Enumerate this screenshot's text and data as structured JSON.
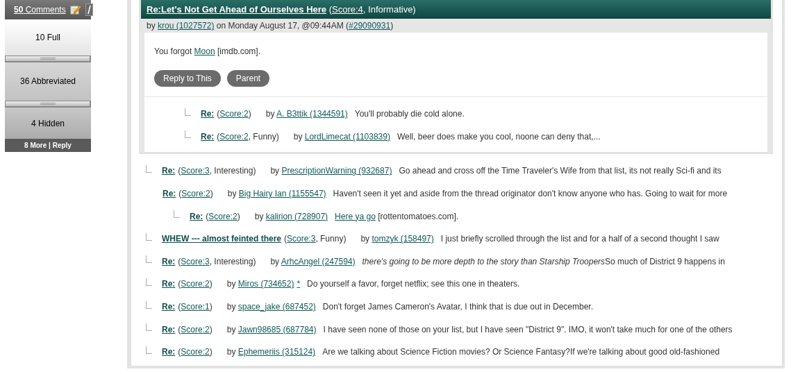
{
  "sidebar": {
    "count": "50",
    "label": "Comments",
    "sections": [
      {
        "label": "10 Full"
      },
      {
        "label": "36 Abbreviated"
      },
      {
        "label": "4 Hidden"
      }
    ],
    "footer": [
      {
        "text": "8 More",
        "kind": "link"
      },
      {
        "text": " | ",
        "kind": "text"
      },
      {
        "text": "Reply",
        "kind": "link"
      }
    ]
  },
  "comment": {
    "title": "Re:Let's Not Get Ahead of Ourselves Here",
    "score": [
      {
        "text": " (",
        "kind": "text"
      },
      {
        "text": "Score:4",
        "kind": "link"
      },
      {
        "text": ", Informative)",
        "kind": "text"
      }
    ],
    "byline": [
      {
        "text": "by ",
        "kind": "text"
      },
      {
        "text": "krou (1027572)",
        "kind": "link"
      },
      {
        "text": " on Monday August 17, @09:44AM (",
        "kind": "text"
      },
      {
        "text": "#29090931",
        "kind": "link"
      },
      {
        "text": ")",
        "kind": "text"
      }
    ],
    "body": [
      {
        "text": "You forgot ",
        "kind": "text"
      },
      {
        "text": "Moon",
        "kind": "link"
      },
      {
        "text": " [imdb.com].",
        "kind": "text"
      }
    ],
    "buttons": [
      "Reply to This",
      "Parent"
    ],
    "children": [
      {
        "connector": true,
        "title": "Re:",
        "score": [
          {
            "text": "(",
            "kind": "text"
          },
          {
            "text": "Score:2",
            "kind": "link"
          },
          {
            "text": ")",
            "kind": "text"
          }
        ],
        "byline": [
          {
            "text": "by ",
            "kind": "text"
          },
          {
            "text": "A. B3ttik (1344591)",
            "kind": "link"
          }
        ],
        "body": [
          {
            "text": "You'll probably die cold alone.",
            "kind": "text"
          }
        ]
      },
      {
        "connector": true,
        "title": "Re:",
        "score": [
          {
            "text": "(",
            "kind": "text"
          },
          {
            "text": "Score:2",
            "kind": "link"
          },
          {
            "text": ", Funny)",
            "kind": "text"
          }
        ],
        "byline": [
          {
            "text": "by ",
            "kind": "text"
          },
          {
            "text": "LordLimecat (1103839)",
            "kind": "link"
          }
        ],
        "body": [
          {
            "text": "Well, beer does make you cool, noone can deny that,...",
            "kind": "text"
          }
        ]
      }
    ]
  },
  "replies": [
    {
      "connector": true,
      "title": "Re:",
      "score": [
        {
          "text": "(",
          "kind": "text"
        },
        {
          "text": "Score:3",
          "kind": "link"
        },
        {
          "text": ", Interesting)",
          "kind": "text"
        }
      ],
      "byline": [
        {
          "text": "by ",
          "kind": "text"
        },
        {
          "text": "PrescriptionWarning (932687)",
          "kind": "link"
        }
      ],
      "body": [
        {
          "text": "Go ahead and cross off the Time Traveler's Wife from that list, its not really Sci-fi and its",
          "kind": "text"
        }
      ]
    },
    {
      "connector": false,
      "title": "Re:",
      "score": [
        {
          "text": "(",
          "kind": "text"
        },
        {
          "text": "Score:2",
          "kind": "link"
        },
        {
          "text": ")",
          "kind": "text"
        }
      ],
      "byline": [
        {
          "text": "by ",
          "kind": "text"
        },
        {
          "text": "Big Hairy Ian (1155547)",
          "kind": "link"
        }
      ],
      "body": [
        {
          "text": "Haven't seen it yet and aside from the thread originator don't know anyone who has. Going to wait for more",
          "kind": "text"
        }
      ],
      "children": [
        {
          "connector": true,
          "title": "Re:",
          "score": [
            {
              "text": "(",
              "kind": "text"
            },
            {
              "text": "Score:2",
              "kind": "link"
            },
            {
              "text": ")",
              "kind": "text"
            }
          ],
          "byline": [
            {
              "text": "by ",
              "kind": "text"
            },
            {
              "text": "kalirion (728907)",
              "kind": "link"
            }
          ],
          "body": [
            {
              "text": "Here ya go",
              "kind": "link"
            },
            {
              "text": " [rottentomatoes.com].",
              "kind": "text"
            }
          ]
        }
      ]
    },
    {
      "connector": true,
      "title": "WHEW --- almost feinted there",
      "score": [
        {
          "text": "(",
          "kind": "text"
        },
        {
          "text": "Score:3",
          "kind": "link"
        },
        {
          "text": ", Funny)",
          "kind": "text"
        }
      ],
      "byline": [
        {
          "text": "by ",
          "kind": "text"
        },
        {
          "text": "tomzyk (158497)",
          "kind": "link"
        }
      ],
      "body": [
        {
          "text": "I just briefly scrolled through the list and for a half of a second thought I saw",
          "kind": "text"
        }
      ]
    },
    {
      "connector": true,
      "title": "Re:",
      "score": [
        {
          "text": "(",
          "kind": "text"
        },
        {
          "text": "Score:3",
          "kind": "link"
        },
        {
          "text": ", Interesting)",
          "kind": "text"
        }
      ],
      "byline": [
        {
          "text": "by ",
          "kind": "text"
        },
        {
          "text": "ArhcAngel (247594)",
          "kind": "link"
        }
      ],
      "body": [
        {
          "text": "there's going to be more depth to the story than Starship Troopers",
          "kind": "italic"
        },
        {
          "text": "So much of District 9 happens in",
          "kind": "text"
        }
      ]
    },
    {
      "connector": true,
      "title": "Re:",
      "score": [
        {
          "text": "(",
          "kind": "text"
        },
        {
          "text": "Score:2",
          "kind": "link"
        },
        {
          "text": ")",
          "kind": "text"
        }
      ],
      "byline": [
        {
          "text": "by ",
          "kind": "text"
        },
        {
          "text": "Miros (734652)",
          "kind": "link"
        },
        {
          "text": "*",
          "kind": "link"
        }
      ],
      "body": [
        {
          "text": "Do yourself a favor, forget netflix; see this one in theaters.",
          "kind": "text"
        }
      ]
    },
    {
      "connector": true,
      "title": "Re:",
      "score": [
        {
          "text": "(",
          "kind": "text"
        },
        {
          "text": "Score:1",
          "kind": "link"
        },
        {
          "text": ")",
          "kind": "text"
        }
      ],
      "byline": [
        {
          "text": "by ",
          "kind": "text"
        },
        {
          "text": "space_jake (687452)",
          "kind": "link"
        }
      ],
      "body": [
        {
          "text": "Don't forget James Cameron's Avatar, I think that is due out in December.",
          "kind": "text"
        }
      ]
    },
    {
      "connector": true,
      "title": "Re:",
      "score": [
        {
          "text": "(",
          "kind": "text"
        },
        {
          "text": "Score:2",
          "kind": "link"
        },
        {
          "text": ")",
          "kind": "text"
        }
      ],
      "byline": [
        {
          "text": "by ",
          "kind": "text"
        },
        {
          "text": "Jawn98685 (687784)",
          "kind": "link"
        }
      ],
      "body": [
        {
          "text": "I have seen none of those on your list, but I have seen \"District 9\". IMO, it won't take much for one of the others",
          "kind": "text"
        }
      ]
    },
    {
      "connector": true,
      "title": "Re:",
      "score": [
        {
          "text": "(",
          "kind": "text"
        },
        {
          "text": "Score:2",
          "kind": "link"
        },
        {
          "text": ")",
          "kind": "text"
        }
      ],
      "byline": [
        {
          "text": "by ",
          "kind": "text"
        },
        {
          "text": "Ephemeriis (315124)",
          "kind": "link"
        }
      ],
      "body": [
        {
          "text": "Are we talking about Science Fiction movies? Or Science Fantasy?If we're talking about good old-fashioned",
          "kind": "text"
        }
      ]
    }
  ]
}
